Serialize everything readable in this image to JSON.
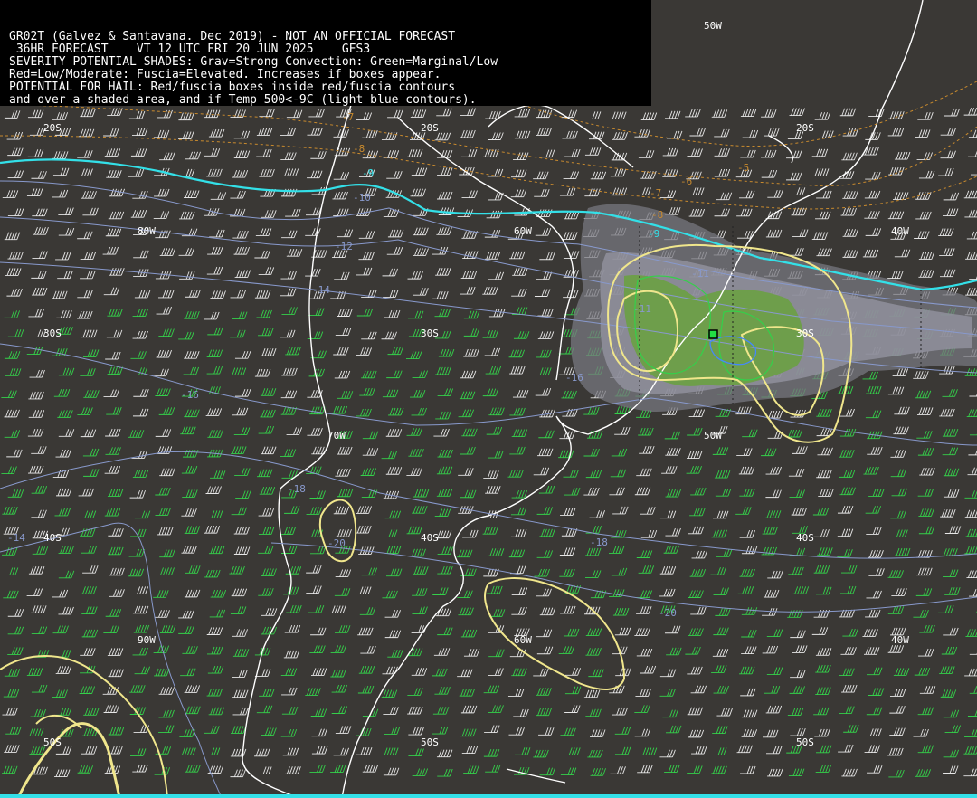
{
  "header": {
    "lines": [
      "GR02T (Galvez & Santavana. Dec 2019) - NOT AN OFFICIAL FORECAST",
      " 36HR FORECAST    VT 12 UTC FRI 20 JUN 2025    GFS3",
      "SEVERITY POTENTIAL SHADES: Grav=Strong Convection: Green=Marginal/Low",
      "Red=Low/Moderate: Fuscia=Elevated. Increases if boxes appear.",
      "POTENTIAL FOR HAIL: Red/fuscia boxes inside red/fuscia contours",
      "and over a shaded area, and if Temp 500<-9C (light blue contours)."
    ]
  },
  "grid_labels": {
    "lon_50w_top": "50W",
    "lat_20s_a": "20S",
    "lat_20s_b": "20S",
    "lat_20s_c": "20S",
    "lon_80w": "80W",
    "lon_60w": "60W",
    "lon_40w": "40W",
    "lat_30s_a": "30S",
    "lat_30s_b": "30S",
    "lat_30s_c": "30S",
    "lon_70w": "70W",
    "lon_50w_mid": "50W",
    "lat_40s_a": "40S",
    "lat_40s_b": "40S",
    "lat_40s_c": "40S",
    "lon_90w": "90W",
    "lon_60w_b": "60W",
    "lon_40w_b": "40W",
    "lat_50s_a": "50S",
    "lat_50s_b": "50S",
    "lat_50s_c": "50S"
  },
  "temp_labels": {
    "t_m7": "-7",
    "t_m8": "-8",
    "t_m6": "-6",
    "t_m5": "-5",
    "t_m7b": "-7",
    "t_m8b": "-8",
    "t_m9": "-9",
    "t_m9b": "-9",
    "t_m10": "-10",
    "t_m11": "-11",
    "t_m11b": "-11",
    "t_m12": "-12",
    "t_m14": "-14",
    "t_m16": "-16",
    "t_m16b": "-16",
    "t_m18": "-18",
    "t_m18b": "-18",
    "t_m20": "-20",
    "t_m20b": "-20",
    "t_m14b": "-14"
  },
  "colors": {
    "background": "#3a3835",
    "coast": "#ffffff",
    "isotherm_cold": "#33e0e8",
    "isotherm": "#8899cc",
    "isotherm_warm": "#c88a2e",
    "severity_contour": "#f0e68c",
    "gray_shade": "#8a8a92",
    "green_shade": "#6aa043",
    "wind_green": "#34d04a",
    "wind_white": "#e6e6e6"
  }
}
